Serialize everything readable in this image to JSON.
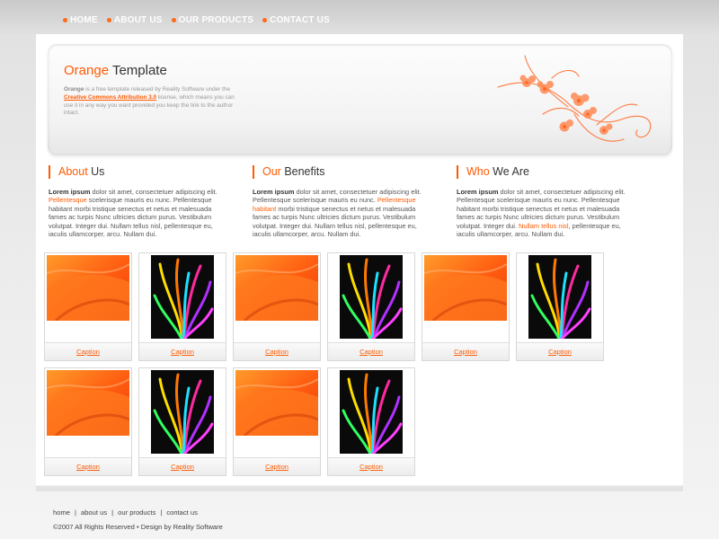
{
  "nav": {
    "items": [
      {
        "label": "HOME"
      },
      {
        "label": "ABOUT US"
      },
      {
        "label": "OUR PRODUCTS"
      },
      {
        "label": "CONTACT US"
      }
    ]
  },
  "hero": {
    "title_accent": "Orange",
    "title_rest": "Template",
    "desc_lead": "Orange",
    "desc_part1": " is a free template released by Reality Software under the ",
    "desc_link": "Creative Commons Attribution 3.0",
    "desc_part2": " license, which means you can use it in any way you want provided you keep the link to the author intact."
  },
  "columns": [
    {
      "head_accent": "About",
      "head_rest": " Us",
      "lead": "Lorem ipsum",
      "text1": " dolor sit amet, consectetuer adipiscing elit. ",
      "accent": "Pellentesque",
      "text2": " scelerisque mauris eu nunc. Pellentesque habitant morbi tristique senectus et netus et malesuada fames ac turpis Nunc ultricies dictum purus. Vestibulum volutpat. Integer dui. Nullam tellus nisl, pellentesque eu, iaculis ullamcorper, arcu. Nullam dui."
    },
    {
      "head_accent": "Our",
      "head_rest": " Benefits",
      "lead": "Lorem ipsum",
      "text1": " dolor sit amet, consectetuer adipiscing elit. Pellentesque scelerisque mauris eu nunc. ",
      "accent": "Pellentesque habitant",
      "text2": " morbi tristique senectus et netus et malesuada fames ac turpis Nunc ultricies dictum purus. Vestibulum volutpat. Integer dui. Nullam tellus nisl, pellentesque eu, iaculis ullamcorper, arcu. Nullam dui."
    },
    {
      "head_accent": "Who",
      "head_rest": " We Are",
      "lead": "Lorem ipsum",
      "text1": " dolor sit amet, consectetuer adipiscing elit. Pellentesque scelerisque mauris eu nunc. Pellentesque habitant morbi tristique senectus et netus et malesuada fames ac turpis Nunc ultricies dictum purus. Vestibulum volutpat. Integer dui. ",
      "accent": "Nullam tellus nisl",
      "text2": ", pellentesque eu, iaculis ullamcorper, arcu. Nullam dui."
    }
  ],
  "gallery": {
    "tiles": [
      {
        "caption": "Caption",
        "image": "orange-abstract"
      },
      {
        "caption": "Caption",
        "image": "rainbow-feathers"
      },
      {
        "caption": "Caption",
        "image": "orange-abstract"
      },
      {
        "caption": "Caption",
        "image": "rainbow-feathers"
      },
      {
        "caption": "Caption",
        "image": "orange-abstract"
      },
      {
        "caption": "Caption",
        "image": "rainbow-feathers"
      },
      {
        "caption": "Caption",
        "image": "orange-abstract"
      },
      {
        "caption": "Caption",
        "image": "rainbow-feathers"
      },
      {
        "caption": "Caption",
        "image": "orange-abstract"
      },
      {
        "caption": "Caption",
        "image": "rainbow-feathers"
      }
    ]
  },
  "footer": {
    "links": [
      {
        "label": "home"
      },
      {
        "label": "about us"
      },
      {
        "label": "our products"
      },
      {
        "label": "contact us"
      }
    ],
    "separator": "|",
    "copyright": "©2007 All Rights Reserved  •  Design by Reality Software"
  },
  "colors": {
    "accent": "#ff5a00",
    "text": "#333333"
  }
}
